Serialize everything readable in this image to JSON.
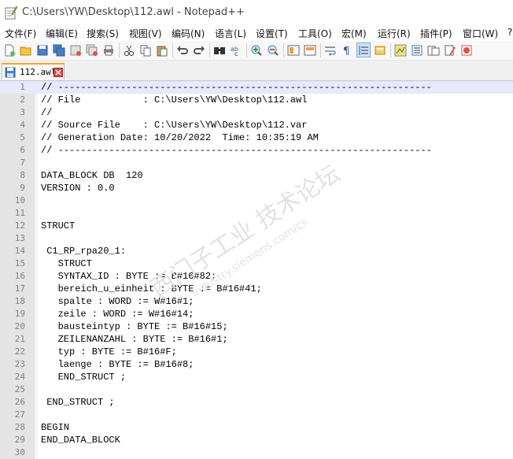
{
  "window": {
    "title": "C:\\Users\\YW\\Desktop\\112.awl - Notepad++"
  },
  "menu": {
    "items": [
      {
        "label": "文件(F)"
      },
      {
        "label": "编辑(E)"
      },
      {
        "label": "搜索(S)"
      },
      {
        "label": "视图(V)"
      },
      {
        "label": "编码(N)"
      },
      {
        "label": "语言(L)"
      },
      {
        "label": "设置(T)"
      },
      {
        "label": "工具(O)"
      },
      {
        "label": "宏(M)"
      },
      {
        "label": "运行(R)"
      },
      {
        "label": "插件(P)"
      },
      {
        "label": "窗口(W)"
      },
      {
        "label": "?"
      }
    ]
  },
  "toolbar": {
    "buttons": [
      "new-file-icon",
      "open-file-icon",
      "save-icon",
      "save-all-icon",
      "close-icon",
      "close-all-icon",
      "print-icon",
      "cut-icon",
      "copy-icon",
      "paste-icon",
      "undo-icon",
      "redo-icon",
      "find-icon",
      "replace-icon",
      "zoom-in-icon",
      "zoom-out-icon",
      "sync-vertical-icon",
      "sync-horizontal-icon",
      "word-wrap-icon",
      "show-all-chars-icon",
      "indent-guide-icon",
      "user-lang-icon",
      "doc-map-icon",
      "function-list-icon",
      "folder-workspace-icon",
      "monitor-icon",
      "record-macro-icon"
    ],
    "pressed_button": "indent-guide-icon"
  },
  "tabs": [
    {
      "label": "112.awl",
      "active": true
    }
  ],
  "editor": {
    "current_line": 1,
    "lines": [
      {
        "n": "1",
        "text": "// ------------------------------------------------------------------"
      },
      {
        "n": "2",
        "text": "// File           : C:\\Users\\YW\\Desktop\\112.awl"
      },
      {
        "n": "3",
        "text": "//"
      },
      {
        "n": "4",
        "text": "// Source File    : C:\\Users\\YW\\Desktop\\112.var"
      },
      {
        "n": "5",
        "text": "// Generation Date: 10/20/2022  Time: 10:35:19 AM"
      },
      {
        "n": "6",
        "text": "// ------------------------------------------------------------------"
      },
      {
        "n": "7",
        "text": ""
      },
      {
        "n": "8",
        "text": "DATA_BLOCK DB  120"
      },
      {
        "n": "9",
        "text": "VERSION : 0.0"
      },
      {
        "n": "10",
        "text": ""
      },
      {
        "n": "11",
        "text": ""
      },
      {
        "n": "12",
        "text": "STRUCT"
      },
      {
        "n": "13",
        "text": ""
      },
      {
        "n": "14",
        "text": " C1_RP_rpa20_1:"
      },
      {
        "n": "15",
        "text": "   STRUCT"
      },
      {
        "n": "16",
        "text": "   SYNTAX_ID : BYTE := B#16#82;"
      },
      {
        "n": "17",
        "text": "   bereich_u_einheit : BYTE := B#16#41;"
      },
      {
        "n": "18",
        "text": "   spalte : WORD := W#16#1;"
      },
      {
        "n": "19",
        "text": "   zeile : WORD := W#16#14;"
      },
      {
        "n": "20",
        "text": "   bausteintyp : BYTE := B#16#15;"
      },
      {
        "n": "21",
        "text": "   ZEILENANZAHL : BYTE := B#16#1;"
      },
      {
        "n": "22",
        "text": "   typ : BYTE := B#16#F;"
      },
      {
        "n": "23",
        "text": "   laenge : BYTE := B#16#8;"
      },
      {
        "n": "24",
        "text": "   END_STRUCT ;"
      },
      {
        "n": "25",
        "text": ""
      },
      {
        "n": "26",
        "text": " END_STRUCT ;"
      },
      {
        "n": "27",
        "text": ""
      },
      {
        "n": "28",
        "text": "BEGIN"
      },
      {
        "n": "29",
        "text": "END_DATA_BLOCK"
      },
      {
        "n": "30",
        "text": ""
      }
    ]
  },
  "watermark": {
    "text_cn": "西门子工业  技术论坛",
    "text_url": "industry.siemens.com/cs"
  },
  "colors": {
    "current_line": "#e8e8ff",
    "gutter": "#e4e4e4",
    "tab_accent": "#f5a623"
  }
}
